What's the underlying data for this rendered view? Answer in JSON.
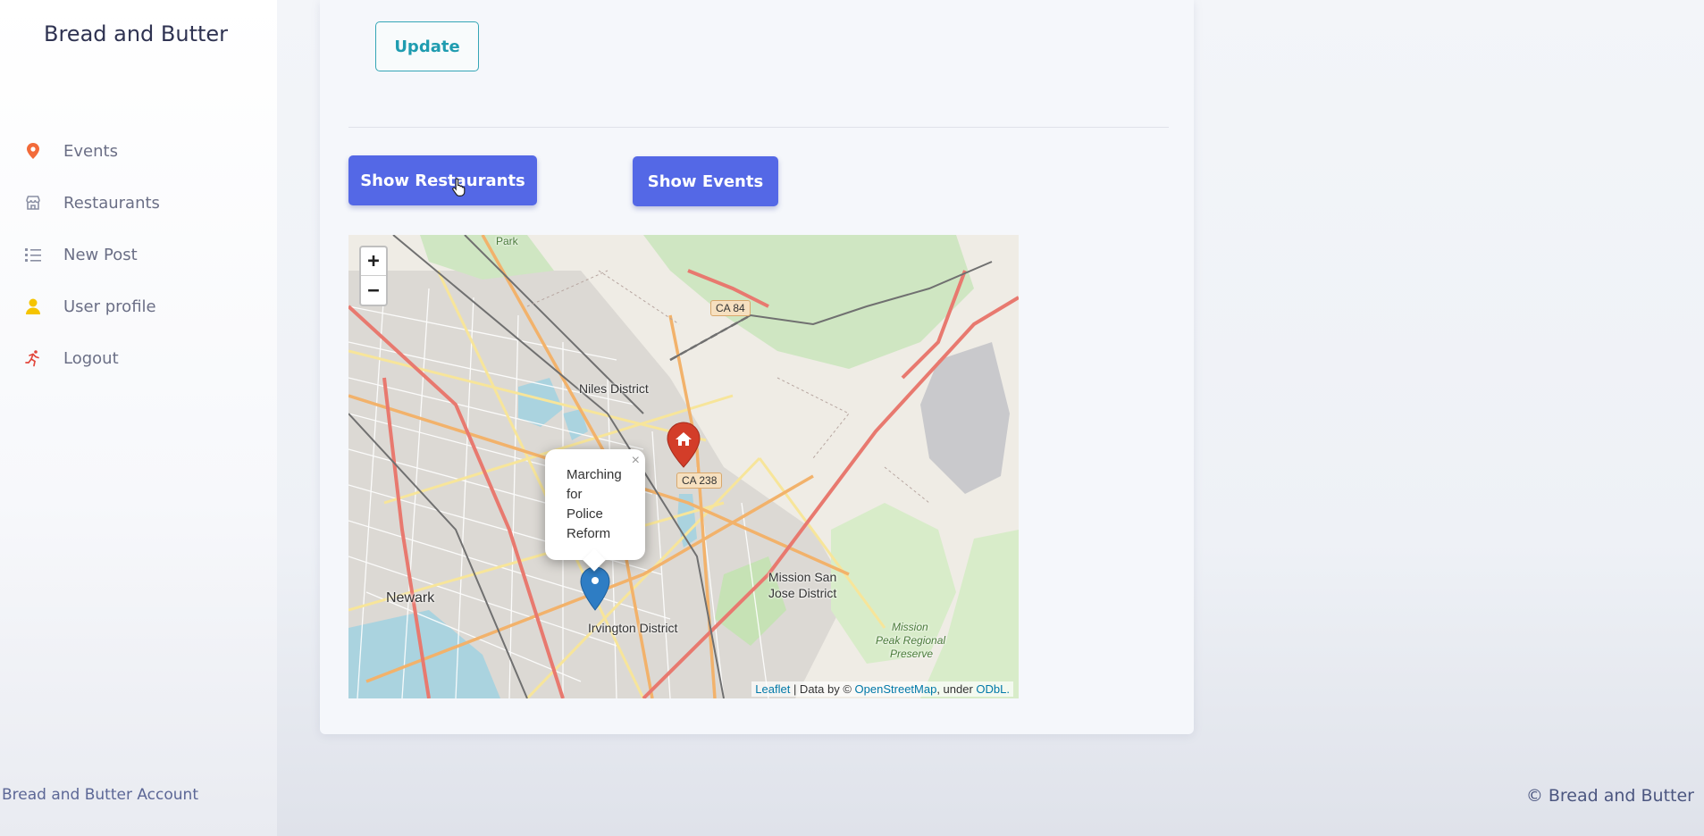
{
  "sidebar": {
    "brand": "Bread and Butter",
    "items": [
      {
        "label": "Events",
        "icon": "map-pin-icon",
        "color": "#f26b3a"
      },
      {
        "label": "Restaurants",
        "icon": "storefront-icon",
        "color": "#8a8fa3"
      },
      {
        "label": "New Post",
        "icon": "list-icon",
        "color": "#8a8fa3"
      },
      {
        "label": "User profile",
        "icon": "user-icon",
        "color": "#f5c400"
      },
      {
        "label": "Logout",
        "icon": "running-person-icon",
        "color": "#e2463b"
      }
    ],
    "footer": "Bread and Butter Account"
  },
  "main": {
    "update_label": "Update",
    "show_restaurants_label": "Show Restaurants",
    "show_events_label": "Show Events",
    "accent": "#5468e6"
  },
  "map": {
    "zoom_in": "+",
    "zoom_out": "−",
    "popup": {
      "text_lines": [
        "Marching",
        "for",
        "Police",
        "Reform"
      ],
      "close": "×"
    },
    "labels": {
      "niles": "Niles District",
      "newark": "Newark",
      "irvington": "Irvington District",
      "mission_line1": "Mission San",
      "mission_line2": "Jose District",
      "preserve_line1": "Mission",
      "preserve_line2": "Peak Regional",
      "preserve_line3": "Preserve",
      "park": "Park"
    },
    "shields": {
      "ca84": "CA 84",
      "ca238": "CA 238"
    },
    "attribution": {
      "leaflet": "Leaflet",
      "data_by": " | Data by © ",
      "osm": "OpenStreetMap",
      "under": ", under ",
      "odbl": "ODbL."
    }
  },
  "footer": {
    "copyright": "© Bread and Butter"
  }
}
